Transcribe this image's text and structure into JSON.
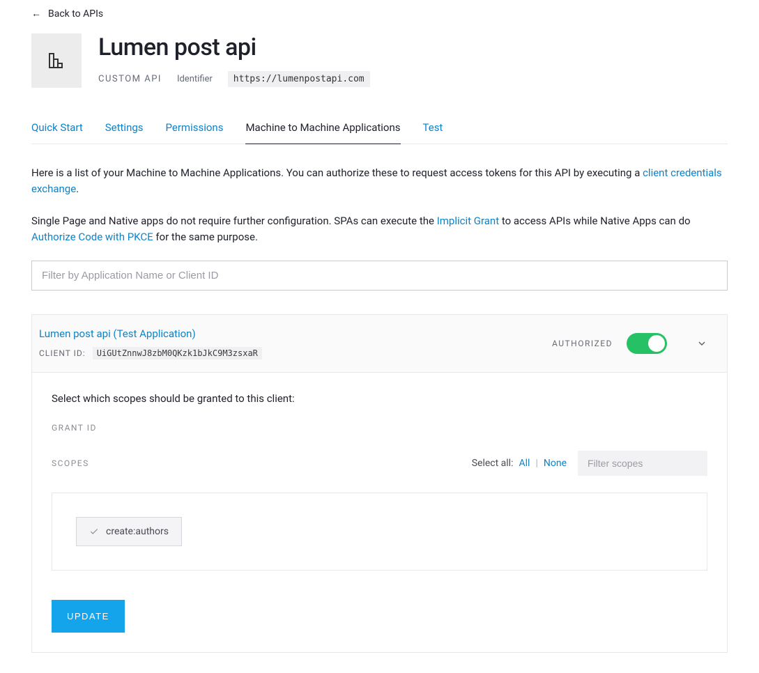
{
  "back_link": "Back to APIs",
  "header": {
    "title": "Lumen post api",
    "type_label": "CUSTOM API",
    "identifier_label": "Identifier",
    "identifier_value": "https://lumenpostapi.com"
  },
  "tabs": [
    {
      "label": "Quick Start",
      "active": false
    },
    {
      "label": "Settings",
      "active": false
    },
    {
      "label": "Permissions",
      "active": false
    },
    {
      "label": "Machine to Machine Applications",
      "active": true
    },
    {
      "label": "Test",
      "active": false
    }
  ],
  "intro": {
    "p1_a": "Here is a list of your Machine to Machine Applications. You can authorize these to request access tokens for this API by executing a ",
    "p1_link": "client credentials exchange",
    "p1_b": ".",
    "p2_a": "Single Page and Native apps do not require further configuration. SPAs can execute the ",
    "p2_link1": "Implicit Grant",
    "p2_b": " to access APIs while Native Apps can do ",
    "p2_link2": "Authorize Code with PKCE",
    "p2_c": " for the same purpose."
  },
  "filter_placeholder": "Filter by Application Name or Client ID",
  "app": {
    "name": "Lumen post api (Test Application)",
    "client_id_label": "CLIENT ID:",
    "client_id": "UiGUtZnnwJ8zbM0QKzk1bJkC9M3zsxaR",
    "authorized_label": "AUTHORIZED",
    "body": {
      "select_text": "Select which scopes should be granted to this client:",
      "grant_id_label": "GRANT ID",
      "scopes_label": "SCOPES",
      "select_all_label": "Select all:",
      "select_all_all": "All",
      "select_all_none": "None",
      "scope_filter_placeholder": "Filter scopes",
      "scopes": [
        {
          "name": "create:authors"
        }
      ],
      "update_button": "UPDATE"
    }
  }
}
